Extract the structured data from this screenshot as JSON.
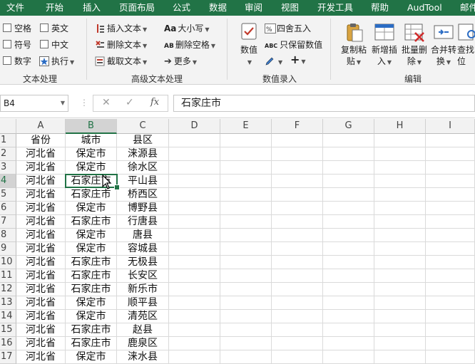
{
  "menu_tabs": [
    "文件",
    "开始",
    "插入",
    "页面布局",
    "公式",
    "数据",
    "审阅",
    "视图",
    "开发工具",
    "帮助",
    "AudTool",
    "邮件"
  ],
  "ribbon": {
    "text_processing": {
      "checkboxes": [
        [
          "空格",
          "英文"
        ],
        [
          "符号",
          "中文"
        ],
        [
          "数字"
        ]
      ],
      "execute_label": "执行",
      "group_label": "文本处理"
    },
    "advanced_text": {
      "buttons": [
        "插入文本",
        "删除文本",
        "截取文本"
      ],
      "right_buttons": [
        "大小写",
        "删除空格",
        "更多"
      ],
      "icons": {
        "case": "Aa",
        "space": "AB"
      },
      "group_label": "高级文本处理"
    },
    "value_entry": {
      "value_label": "数值",
      "round_label": "四舍五入",
      "keep_value_label": "只保留数值",
      "keep_value_icon": "ABC",
      "group_label": "数值录入"
    },
    "edit": {
      "buttons": [
        {
          "line1": "复制粘",
          "line2": "贴"
        },
        {
          "line1": "新增插",
          "line2": "入"
        },
        {
          "line1": "批量删",
          "line2": "除"
        },
        {
          "line1": "合并转",
          "line2": "换"
        },
        {
          "line1": "查找",
          "line2": "位"
        }
      ],
      "group_label": "编辑"
    }
  },
  "formula_bar": {
    "name_box": "B4",
    "cancel": "✕",
    "enter": "✓",
    "fx": "fx",
    "content": "石家庄市"
  },
  "columns": [
    "A",
    "B",
    "C",
    "D",
    "E",
    "F",
    "G",
    "H",
    "I"
  ],
  "selected_column": "B",
  "selected_row": 4,
  "rows": [
    {
      "num": "1",
      "a": "省份",
      "b": "城市",
      "c": "县区"
    },
    {
      "num": "2",
      "a": "河北省",
      "b": "保定市",
      "c": "涞源县"
    },
    {
      "num": "3",
      "a": "河北省",
      "b": "保定市",
      "c": "徐水区"
    },
    {
      "num": "4",
      "a": "河北省",
      "b": "石家庄市",
      "c": "平山县"
    },
    {
      "num": "5",
      "a": "河北省",
      "b": "石家庄市",
      "c": "桥西区"
    },
    {
      "num": "6",
      "a": "河北省",
      "b": "保定市",
      "c": "博野县"
    },
    {
      "num": "7",
      "a": "河北省",
      "b": "石家庄市",
      "c": "行唐县"
    },
    {
      "num": "8",
      "a": "河北省",
      "b": "保定市",
      "c": "唐县"
    },
    {
      "num": "9",
      "a": "河北省",
      "b": "保定市",
      "c": "容城县"
    },
    {
      "num": "10",
      "a": "河北省",
      "b": "石家庄市",
      "c": "无极县"
    },
    {
      "num": "11",
      "a": "河北省",
      "b": "石家庄市",
      "c": "长安区"
    },
    {
      "num": "12",
      "a": "河北省",
      "b": "石家庄市",
      "c": "新乐市"
    },
    {
      "num": "13",
      "a": "河北省",
      "b": "保定市",
      "c": "顺平县"
    },
    {
      "num": "14",
      "a": "河北省",
      "b": "保定市",
      "c": "清苑区"
    },
    {
      "num": "15",
      "a": "河北省",
      "b": "石家庄市",
      "c": "赵县"
    },
    {
      "num": "16",
      "a": "河北省",
      "b": "石家庄市",
      "c": "鹿泉区"
    },
    {
      "num": "17",
      "a": "河北省",
      "b": "保定市",
      "c": "涞水县"
    }
  ],
  "colors": {
    "accent": "#217346",
    "header_bg": "#f2f2f2",
    "selected_header": "#d3d3d3"
  }
}
